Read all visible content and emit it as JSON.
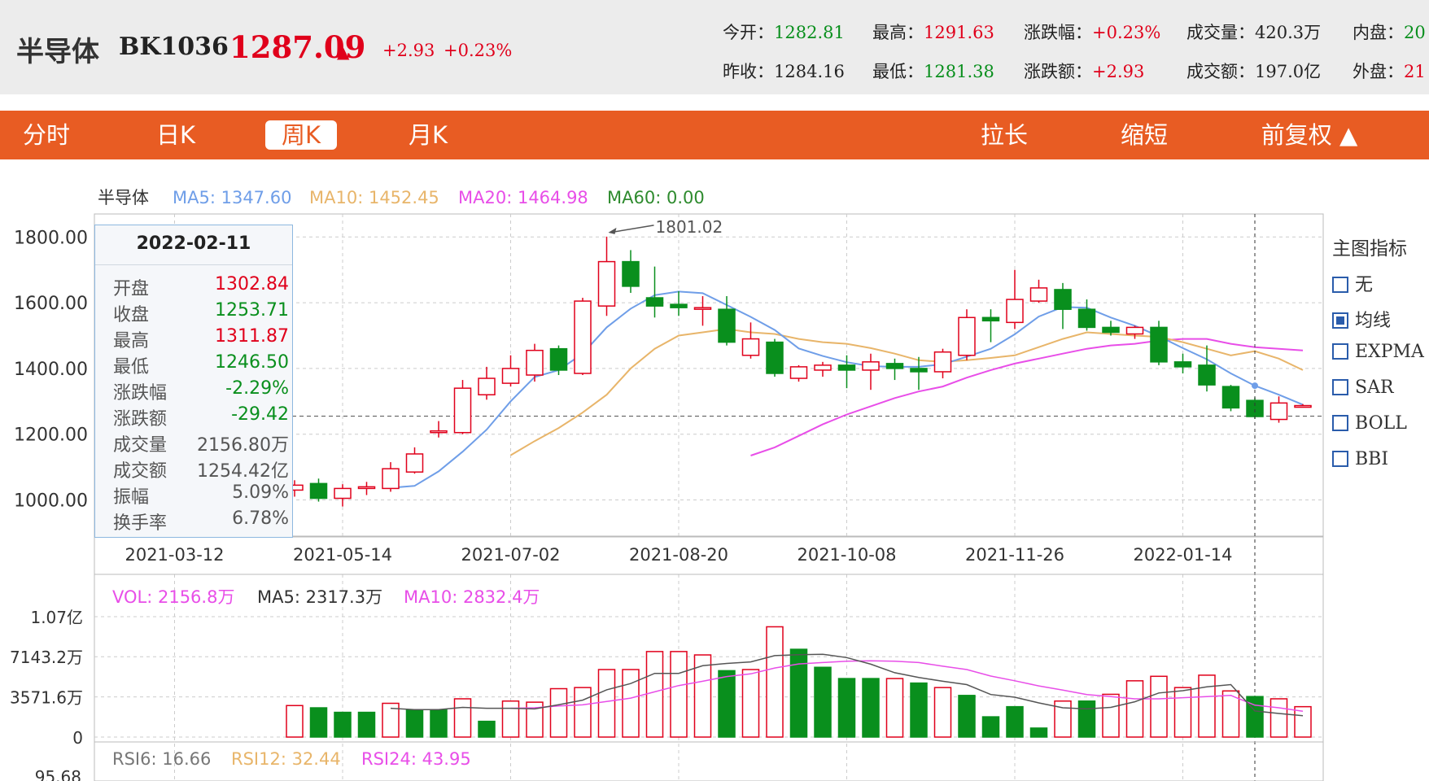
{
  "header": {
    "name": "半导体",
    "code": "BK1036",
    "price": "1287.09",
    "arrow": "▲",
    "change_abs": "+2.93",
    "change_pct": "+0.23%",
    "quotes_row1": [
      {
        "label": "今开：",
        "value": "1282.81",
        "color": "#098f1d"
      },
      {
        "label": "最高：",
        "value": "1291.63",
        "color": "#e0001b"
      },
      {
        "label": "涨跌幅：",
        "value": "+0.23%",
        "color": "#e0001b"
      },
      {
        "label": "成交量：",
        "value": "420.3万",
        "color": "#222222"
      },
      {
        "label": "内盘：",
        "value": "20",
        "color": "#098f1d"
      }
    ],
    "quotes_row2": [
      {
        "label": "昨收：",
        "value": "1284.16",
        "color": "#222222"
      },
      {
        "label": "最低：",
        "value": "1281.38",
        "color": "#098f1d"
      },
      {
        "label": "涨跌额：",
        "value": "+2.93",
        "color": "#e0001b"
      },
      {
        "label": "成交额：",
        "value": "197.0亿",
        "color": "#222222"
      },
      {
        "label": "外盘：",
        "value": "21",
        "color": "#e0001b"
      }
    ]
  },
  "tabs": {
    "fenshi": "分时",
    "rik": "日K",
    "zhouk": "周K",
    "yuek": "月K",
    "lachang": "拉长",
    "suoduan": "缩短",
    "fuquan": "前复权 ▲"
  },
  "indicators": {
    "title": "主图指标",
    "items": [
      {
        "label": "无",
        "checked": false
      },
      {
        "label": "均线",
        "checked": true
      },
      {
        "label": "EXPMA",
        "checked": false
      },
      {
        "label": "SAR",
        "checked": false
      },
      {
        "label": "BOLL",
        "checked": false
      },
      {
        "label": "BBI",
        "checked": false
      }
    ]
  },
  "info": {
    "date": "2022-02-11",
    "rows": [
      {
        "k": "开盘",
        "v": "1302.84",
        "color": "#e0001b"
      },
      {
        "k": "收盘",
        "v": "1253.71",
        "color": "#098f1d"
      },
      {
        "k": "最高",
        "v": "1311.87",
        "color": "#e0001b"
      },
      {
        "k": "最低",
        "v": "1246.50",
        "color": "#098f1d"
      },
      {
        "k": "涨跌幅",
        "v": "-2.29%",
        "color": "#098f1d"
      },
      {
        "k": "涨跌额",
        "v": "-29.42",
        "color": "#098f1d"
      },
      {
        "k": "成交量",
        "v": "2156.80万",
        "color": "#555555"
      },
      {
        "k": "成交额",
        "v": "1254.42亿",
        "color": "#555555"
      },
      {
        "k": "振幅",
        "v": "5.09%",
        "color": "#555555"
      },
      {
        "k": "换手率",
        "v": "6.78%",
        "color": "#555555"
      }
    ]
  },
  "colors": {
    "up": "#e0001b",
    "down": "#098f1d",
    "ma5": "#6f9ee8",
    "ma10": "#e8b56a",
    "ma20": "#e84ee8",
    "ma60": "#2e8b2e",
    "bar_orange": "#e85c23"
  },
  "chart_data": {
    "type": "candlestick",
    "main_legend": {
      "name": "半导体",
      "ma5": "MA5: 1347.60",
      "ma10": "MA10: 1452.45",
      "ma20": "MA20: 1464.98",
      "ma60": "MA60: 0.00"
    },
    "y_ticks": [
      "1800.00",
      "1600.00",
      "1400.00",
      "1200.00",
      "1000.00"
    ],
    "y_tick_values": [
      1800,
      1600,
      1400,
      1200,
      1000
    ],
    "ylim": [
      890,
      1870
    ],
    "x_ticks": [
      {
        "label": "2021-03-12",
        "index": -5
      },
      {
        "label": "2021-05-14",
        "index": 2
      },
      {
        "label": "2021-07-02",
        "index": 9
      },
      {
        "label": "2021-08-20",
        "index": 16
      },
      {
        "label": "2021-10-08",
        "index": 23
      },
      {
        "label": "2021-11-26",
        "index": 30
      },
      {
        "label": "2022-01-14",
        "index": 37
      }
    ],
    "max_annotation": {
      "label": "1801.02",
      "index": 13,
      "value": 1801.02
    },
    "current_price_line": 1255,
    "crosshair_index": 40,
    "candles": [
      {
        "o": 1030,
        "c": 1045,
        "h": 1060,
        "l": 1010
      },
      {
        "o": 1050,
        "c": 1005,
        "h": 1065,
        "l": 995
      },
      {
        "o": 1005,
        "c": 1035,
        "h": 1048,
        "l": 980
      },
      {
        "o": 1035,
        "c": 1040,
        "h": 1055,
        "l": 1015
      },
      {
        "o": 1035,
        "c": 1095,
        "h": 1115,
        "l": 1025
      },
      {
        "o": 1085,
        "c": 1140,
        "h": 1160,
        "l": 1080
      },
      {
        "o": 1205,
        "c": 1210,
        "h": 1240,
        "l": 1190
      },
      {
        "o": 1205,
        "c": 1340,
        "h": 1365,
        "l": 1200
      },
      {
        "o": 1320,
        "c": 1370,
        "h": 1405,
        "l": 1305
      },
      {
        "o": 1355,
        "c": 1400,
        "h": 1440,
        "l": 1345
      },
      {
        "o": 1380,
        "c": 1455,
        "h": 1475,
        "l": 1360
      },
      {
        "o": 1460,
        "c": 1395,
        "h": 1470,
        "l": 1380
      },
      {
        "o": 1385,
        "c": 1605,
        "h": 1615,
        "l": 1380
      },
      {
        "o": 1590,
        "c": 1725,
        "h": 1801,
        "l": 1560
      },
      {
        "o": 1725,
        "c": 1650,
        "h": 1760,
        "l": 1630
      },
      {
        "o": 1615,
        "c": 1590,
        "h": 1710,
        "l": 1555
      },
      {
        "o": 1595,
        "c": 1585,
        "h": 1635,
        "l": 1560
      },
      {
        "o": 1585,
        "c": 1585,
        "h": 1620,
        "l": 1530
      },
      {
        "o": 1580,
        "c": 1480,
        "h": 1620,
        "l": 1470
      },
      {
        "o": 1440,
        "c": 1490,
        "h": 1540,
        "l": 1430
      },
      {
        "o": 1480,
        "c": 1385,
        "h": 1490,
        "l": 1375
      },
      {
        "o": 1370,
        "c": 1405,
        "h": 1410,
        "l": 1360
      },
      {
        "o": 1395,
        "c": 1410,
        "h": 1420,
        "l": 1375
      },
      {
        "o": 1410,
        "c": 1395,
        "h": 1440,
        "l": 1340
      },
      {
        "o": 1395,
        "c": 1420,
        "h": 1445,
        "l": 1335
      },
      {
        "o": 1415,
        "c": 1400,
        "h": 1430,
        "l": 1365
      },
      {
        "o": 1400,
        "c": 1390,
        "h": 1435,
        "l": 1335
      },
      {
        "o": 1390,
        "c": 1450,
        "h": 1460,
        "l": 1370
      },
      {
        "o": 1440,
        "c": 1555,
        "h": 1580,
        "l": 1425
      },
      {
        "o": 1555,
        "c": 1545,
        "h": 1580,
        "l": 1480
      },
      {
        "o": 1540,
        "c": 1610,
        "h": 1700,
        "l": 1520
      },
      {
        "o": 1605,
        "c": 1645,
        "h": 1670,
        "l": 1600
      },
      {
        "o": 1640,
        "c": 1580,
        "h": 1660,
        "l": 1520
      },
      {
        "o": 1580,
        "c": 1525,
        "h": 1610,
        "l": 1515
      },
      {
        "o": 1525,
        "c": 1510,
        "h": 1545,
        "l": 1500
      },
      {
        "o": 1505,
        "c": 1525,
        "h": 1530,
        "l": 1490
      },
      {
        "o": 1525,
        "c": 1420,
        "h": 1545,
        "l": 1410
      },
      {
        "o": 1420,
        "c": 1405,
        "h": 1445,
        "l": 1385
      },
      {
        "o": 1410,
        "c": 1350,
        "h": 1470,
        "l": 1330
      },
      {
        "o": 1345,
        "c": 1280,
        "h": 1350,
        "l": 1270
      },
      {
        "o": 1302.84,
        "c": 1253.71,
        "h": 1311.87,
        "l": 1246.5
      },
      {
        "o": 1245,
        "c": 1295,
        "h": 1315,
        "l": 1235
      },
      {
        "o": 1282.81,
        "c": 1287.09,
        "h": 1291.63,
        "l": 1281.38
      }
    ],
    "ma5": [
      null,
      null,
      null,
      null,
      1037,
      1043,
      1087,
      1147,
      1214,
      1300,
      1374,
      1395,
      1445,
      1525,
      1582,
      1623,
      1634,
      1629,
      1593,
      1557,
      1517,
      1461,
      1438,
      1419,
      1407,
      1405,
      1405,
      1413,
      1436,
      1460,
      1504,
      1558,
      1587,
      1585,
      1555,
      1530,
      1498,
      1462,
      1428,
      1385,
      1347.6,
      1320,
      1290
    ],
    "ma10": [
      null,
      null,
      null,
      null,
      null,
      null,
      null,
      null,
      null,
      1136,
      1179,
      1219,
      1266,
      1320,
      1400,
      1460,
      1500,
      1510,
      1520,
      1510,
      1505,
      1490,
      1480,
      1475,
      1462,
      1445,
      1425,
      1420,
      1425,
      1432,
      1440,
      1465,
      1490,
      1510,
      1505,
      1500,
      1496,
      1480,
      1460,
      1440,
      1452.45,
      1430,
      1395
    ],
    "ma20": [
      null,
      null,
      null,
      null,
      null,
      null,
      null,
      null,
      null,
      null,
      null,
      null,
      null,
      null,
      null,
      null,
      null,
      null,
      null,
      1135,
      1160,
      1195,
      1230,
      1260,
      1285,
      1310,
      1330,
      1345,
      1372,
      1395,
      1415,
      1430,
      1445,
      1460,
      1470,
      1475,
      1485,
      1490,
      1490,
      1475,
      1464.98,
      1460,
      1455
    ],
    "volume": {
      "legend": {
        "vol": "VOL: 2156.8万",
        "ma5": "MA5: 2317.3万",
        "ma10": "MA10: 2832.4万"
      },
      "y_ticks": [
        "1.07亿",
        "7143.2万",
        "3571.6万",
        "0"
      ],
      "y_tick_values": [
        10700,
        7143.2,
        3571.6,
        0
      ],
      "ylim": [
        0,
        10700
      ],
      "unit": "万",
      "values": [
        2800,
        2600,
        2200,
        2200,
        3000,
        2400,
        2400,
        3400,
        1400,
        3200,
        3100,
        4300,
        4400,
        6000,
        6000,
        7600,
        7600,
        7300,
        5900,
        6000,
        9800,
        7800,
        6200,
        5200,
        5200,
        5200,
        4800,
        4400,
        3700,
        1800,
        2700,
        800,
        3200,
        3200,
        3800,
        5000,
        5400,
        4400,
        5500,
        4100,
        3600,
        3400,
        2700
      ],
      "ma5": [
        null,
        null,
        null,
        null,
        2560,
        2440,
        2440,
        2640,
        2560,
        2560,
        2500,
        2880,
        3280,
        4200,
        4760,
        5660,
        5660,
        6340,
        6540,
        6680,
        7240,
        7320,
        7360,
        7060,
        6480,
        5720,
        5300,
        4960,
        4660,
        3780,
        3540,
        3040,
        2600,
        2500,
        2640,
        3140,
        3920,
        4120,
        4460,
        4660,
        2317.3,
        2100,
        1900
      ],
      "ma10": [
        null,
        null,
        null,
        null,
        null,
        null,
        null,
        null,
        null,
        2560,
        2600,
        2760,
        2860,
        3160,
        3460,
        4020,
        4580,
        4960,
        5380,
        5620,
        6140,
        6500,
        6620,
        6740,
        6780,
        6740,
        6620,
        6300,
        6000,
        5420,
        5000,
        4550,
        4180,
        3780,
        3600,
        3400,
        3400,
        3500,
        3600,
        3700,
        2832.4,
        2600,
        2300
      ],
      "bar_colors": [
        "up",
        "down",
        "down",
        "down",
        "up",
        "down",
        "down",
        "up",
        "down",
        "up",
        "up",
        "up",
        "up",
        "up",
        "up",
        "up",
        "up",
        "up",
        "down",
        "up",
        "up",
        "down",
        "down",
        "down",
        "down",
        "up",
        "down",
        "up",
        "down",
        "down",
        "down",
        "down",
        "up",
        "down",
        "up",
        "up",
        "up",
        "up",
        "up",
        "up",
        "down",
        "up",
        "up"
      ]
    },
    "rsi": {
      "legend": {
        "rsi6": "RSI6: 16.66",
        "rsi12": "RSI12: 32.44",
        "rsi24": "RSI24: 43.95"
      },
      "y_tick": "95.68"
    }
  }
}
